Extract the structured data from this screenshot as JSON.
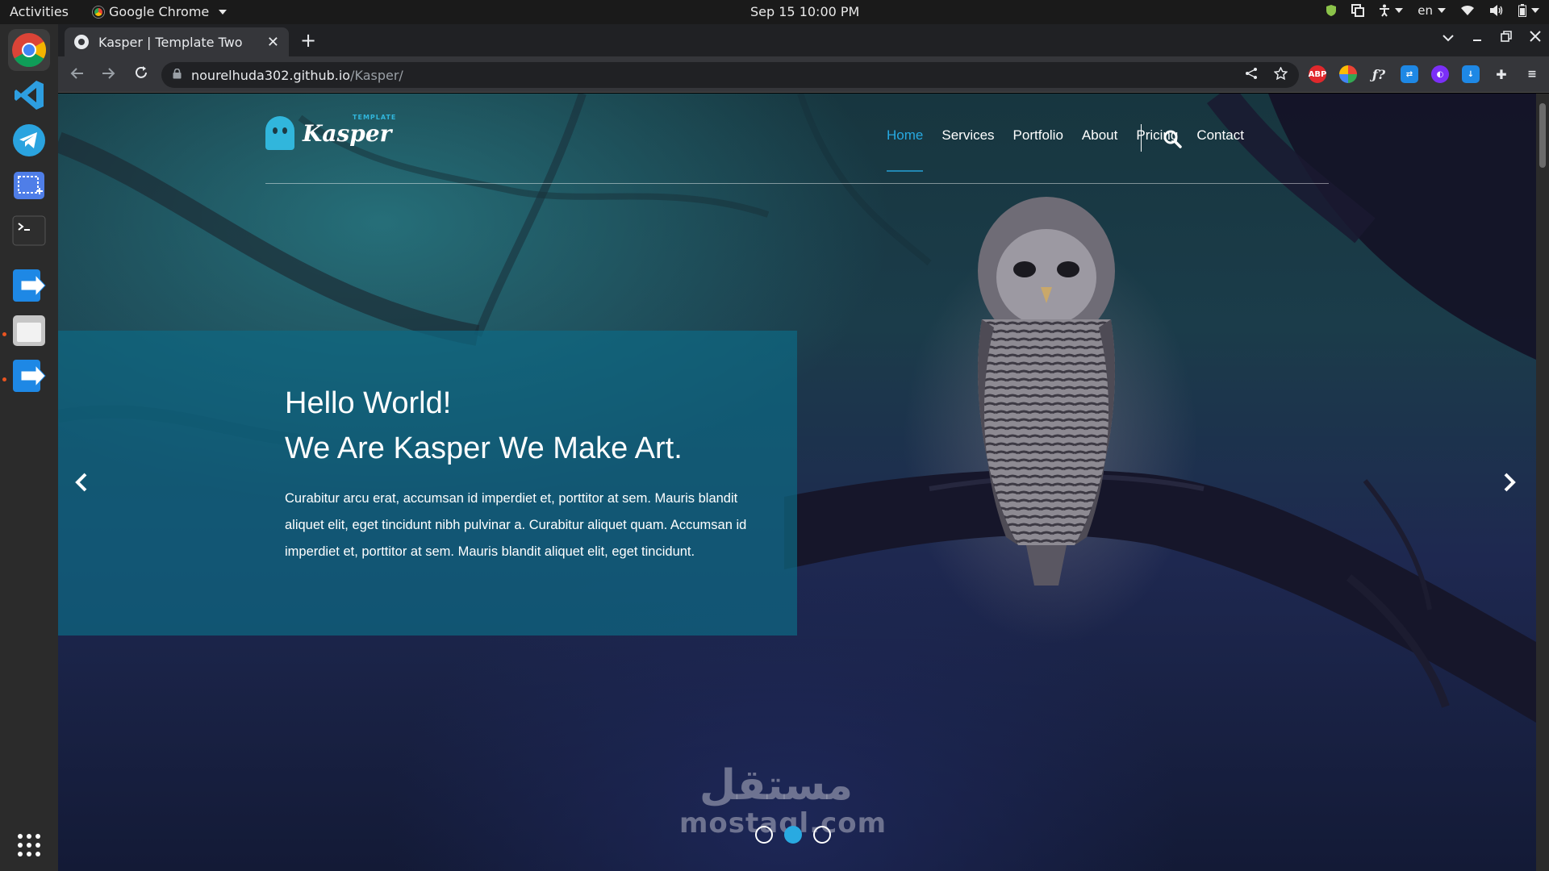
{
  "system": {
    "activities_label": "Activities",
    "app_menu_label": "Google Chrome",
    "clock": "Sep 15  10:00 PM",
    "language": "en"
  },
  "browser": {
    "tab_title": "Kasper | Template Two",
    "new_tab_symbol": "+",
    "close_tab_symbol": "✕",
    "url_host": "nourelhuda302.github.io",
    "url_path": "/Kasper/",
    "extensions": [
      "adblock-plus",
      "color-picker",
      "formula",
      "translate",
      "extension-purple",
      "download",
      "puzzle"
    ]
  },
  "dock": {
    "apps": [
      "chrome",
      "vscode",
      "telegram",
      "screenshot",
      "terminal",
      "app-transfer",
      "files",
      "app-transfer-2",
      "show-apps"
    ]
  },
  "site": {
    "logo_word": "Kasper",
    "logo_tag": "TEMPLATE",
    "nav": [
      "Home",
      "Services",
      "Portfolio",
      "About",
      "Pricing",
      "Contact"
    ],
    "active_nav_index": 0,
    "accent_color": "#27a9e1"
  },
  "hero": {
    "title_line1": "Hello World!",
    "title_line2": "We Are Kasper We Make Art.",
    "paragraph": "Curabitur arcu erat, accumsan id imperdiet et, porttitor at sem. Mauris blandit aliquet elit, eget tincidunt nibh pulvinar a. Curabitur aliquet quam. Accumsan id imperdiet et, porttitor at sem. Mauris blandit aliquet elit, eget tincidunt.",
    "slides_total": 3,
    "active_slide": 2
  },
  "watermark": {
    "arabic": "مستقل",
    "latin": "mostaql.com"
  }
}
